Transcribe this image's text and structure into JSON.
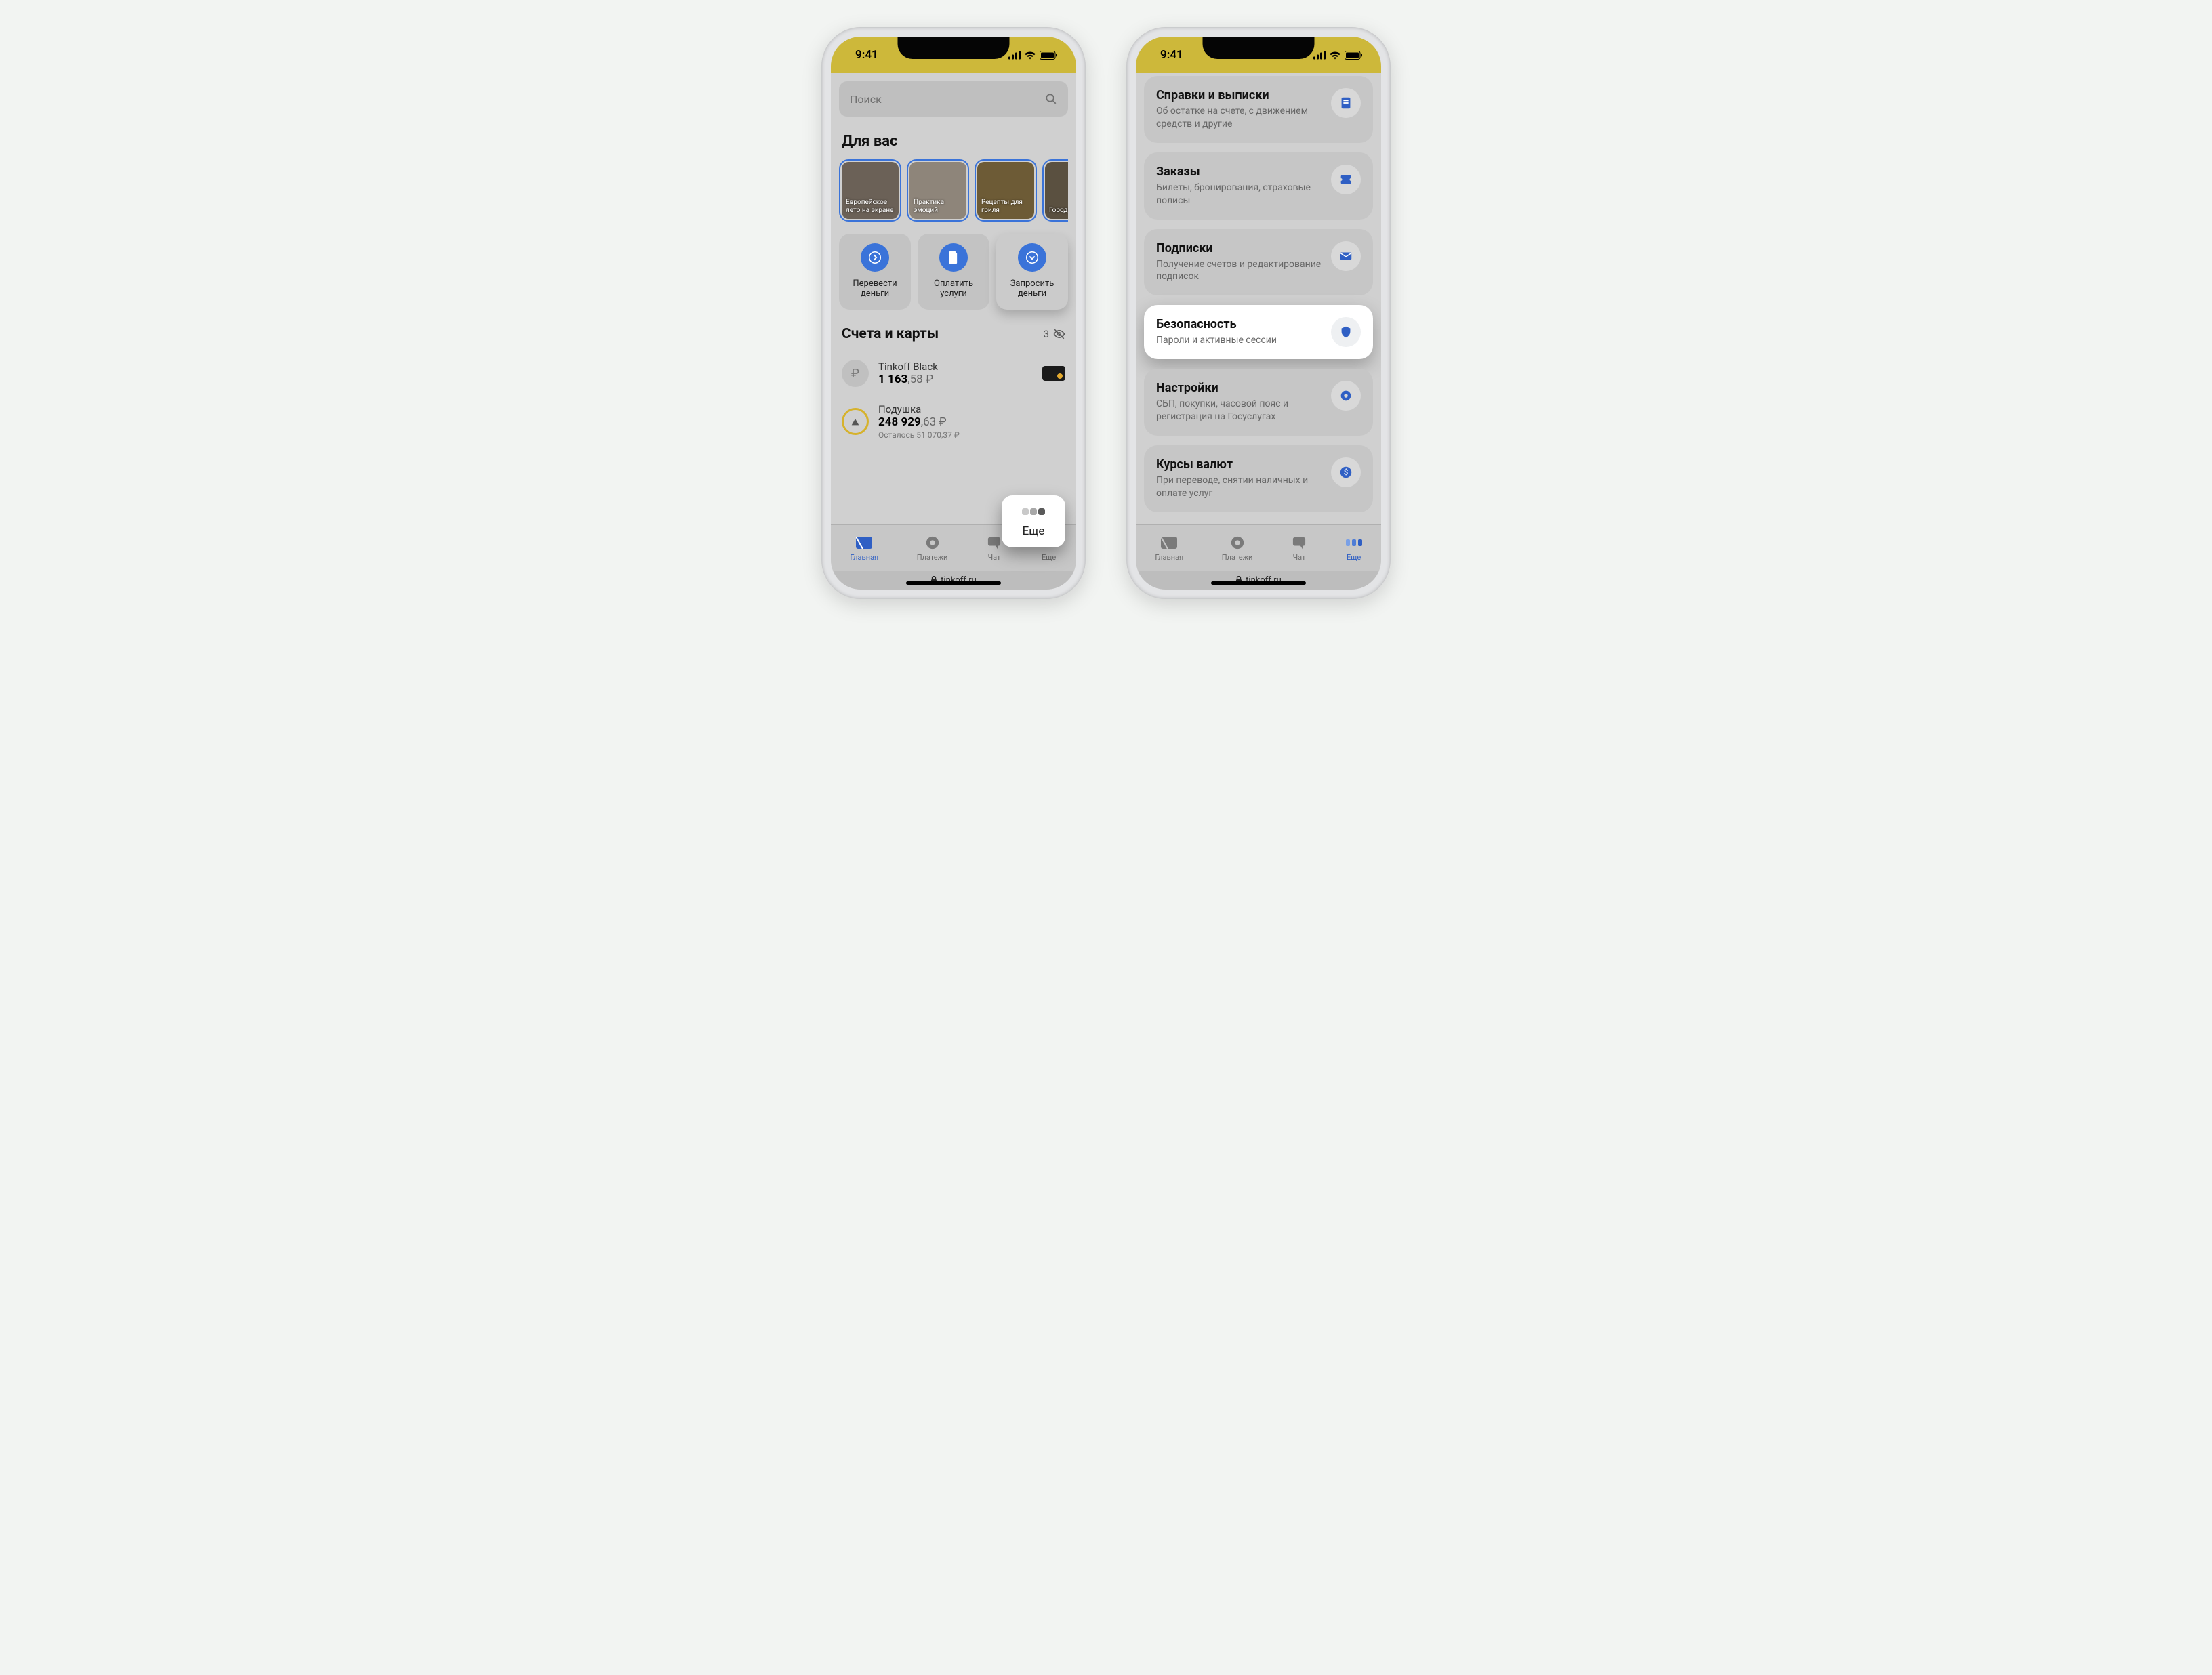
{
  "status": {
    "time": "9:41"
  },
  "phone1": {
    "search_placeholder": "Поиск",
    "for_you": "Для вас",
    "stories": [
      {
        "label": "Европейское\nлето на экране",
        "bg": "#6b6157"
      },
      {
        "label": "Практика\nэмоций",
        "bg": "#8e857a"
      },
      {
        "label": "Рецепты\nдля гриля",
        "bg": "#6d5b36"
      },
      {
        "label": "Города\nкиноге",
        "bg": "#5a5040"
      }
    ],
    "actions": [
      {
        "label": "Перевести деньги"
      },
      {
        "label": "Оплатить услуги"
      },
      {
        "label": "Запросить деньги"
      }
    ],
    "accounts_title": "Счета и карты",
    "accounts_hidden": "3",
    "accounts": [
      {
        "name": "Tinkoff Black",
        "amt_int": "1 163",
        "amt_dec": ",58 ₽",
        "card": true
      },
      {
        "name": "Подушка",
        "amt_int": "248 929",
        "amt_dec": ",63 ₽",
        "sub": "Осталось 51 070,37 ₽",
        "goal": true
      }
    ],
    "popover_label": "Еще",
    "url": "tinkoff.ru"
  },
  "phone2": {
    "items": [
      {
        "title": "Справки и выписки",
        "desc": "Об остатке на счете, с движением средств и другие",
        "icon": "doc"
      },
      {
        "title": "Заказы",
        "desc": "Билеты, бронирования, страховые полисы",
        "icon": "ticket"
      },
      {
        "title": "Подписки",
        "desc": "Получение счетов и редактирование подписок",
        "icon": "mail"
      },
      {
        "title": "Безопасность",
        "desc": "Пароли и активные сессии",
        "icon": "shield",
        "hl": true
      },
      {
        "title": "Настройки",
        "desc": "СБП, покупки, часовой пояс и регистрация на Госуслугах",
        "icon": "gear"
      },
      {
        "title": "Курсы валют",
        "desc": "При переводе, снятии наличных и оплате услуг",
        "icon": "dollar"
      }
    ],
    "url": "tinkoff.ru"
  },
  "tabs": [
    {
      "label": "Главная"
    },
    {
      "label": "Платежи"
    },
    {
      "label": "Чат"
    },
    {
      "label": "Еще"
    }
  ]
}
